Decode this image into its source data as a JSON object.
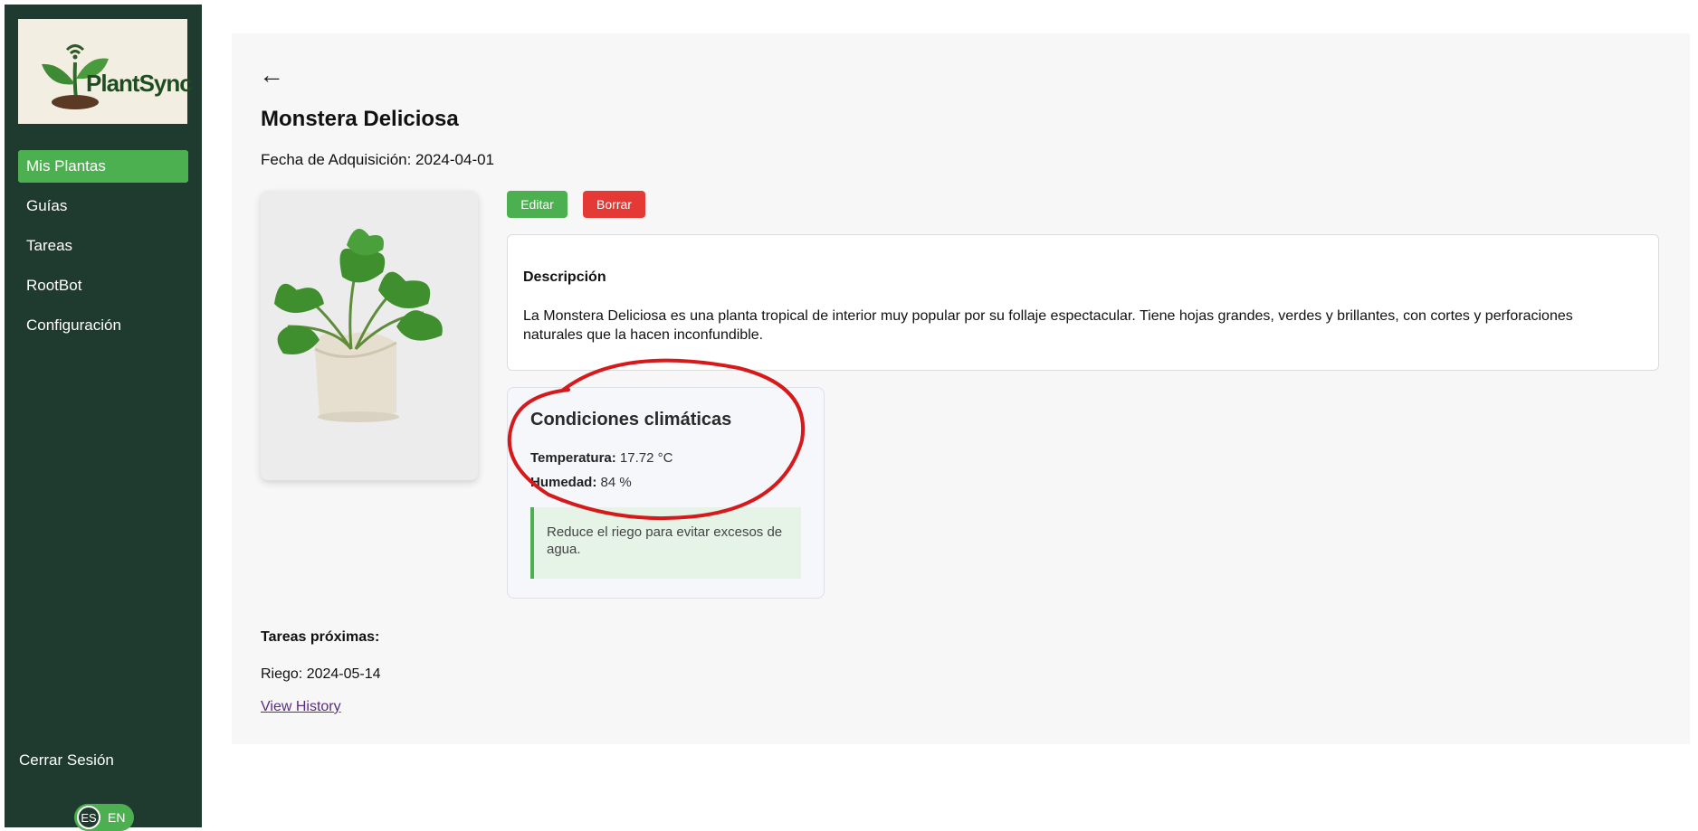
{
  "sidebar": {
    "logo_text": "PlantSync",
    "items": [
      {
        "label": "Mis Plantas",
        "active": true
      },
      {
        "label": "Guías",
        "active": false
      },
      {
        "label": "Tareas",
        "active": false
      },
      {
        "label": "RootBot",
        "active": false
      },
      {
        "label": "Configuración",
        "active": false
      }
    ],
    "logout_label": "Cerrar Sesión",
    "language": {
      "es": "ES",
      "en": "EN",
      "selected": "ES"
    }
  },
  "plant": {
    "back_icon": "arrow-left-icon",
    "back_glyph": "←",
    "name": "Monstera Deliciosa",
    "acquisition": "Fecha de Adquisición: 2024-04-01",
    "edit_label": "Editar",
    "delete_label": "Borrar",
    "description": {
      "title": "Descripción",
      "text": "La Monstera Deliciosa es una planta tropical de interior muy popular por su follaje espectacular. Tiene hojas grandes, verdes y brillantes, con cortes y perforaciones naturales que la hacen inconfundible."
    },
    "climate": {
      "title": "Condiciones climáticas",
      "temperature_label": "Temperatura:",
      "temperature_value": "17.72 °C",
      "humidity_label": "Humedad:",
      "humidity_value": "84 %",
      "advice": "Reduce el riego para evitar excesos de agua."
    },
    "tasks": {
      "label": "Tareas próximas:",
      "items": [
        "Riego: 2024-05-14"
      ],
      "history_label": "View History"
    }
  },
  "colors": {
    "sidebar_bg": "#1f3a2e",
    "accent_green": "#4caf50",
    "danger_red": "#e53935",
    "annotation_red": "#d6191b"
  }
}
